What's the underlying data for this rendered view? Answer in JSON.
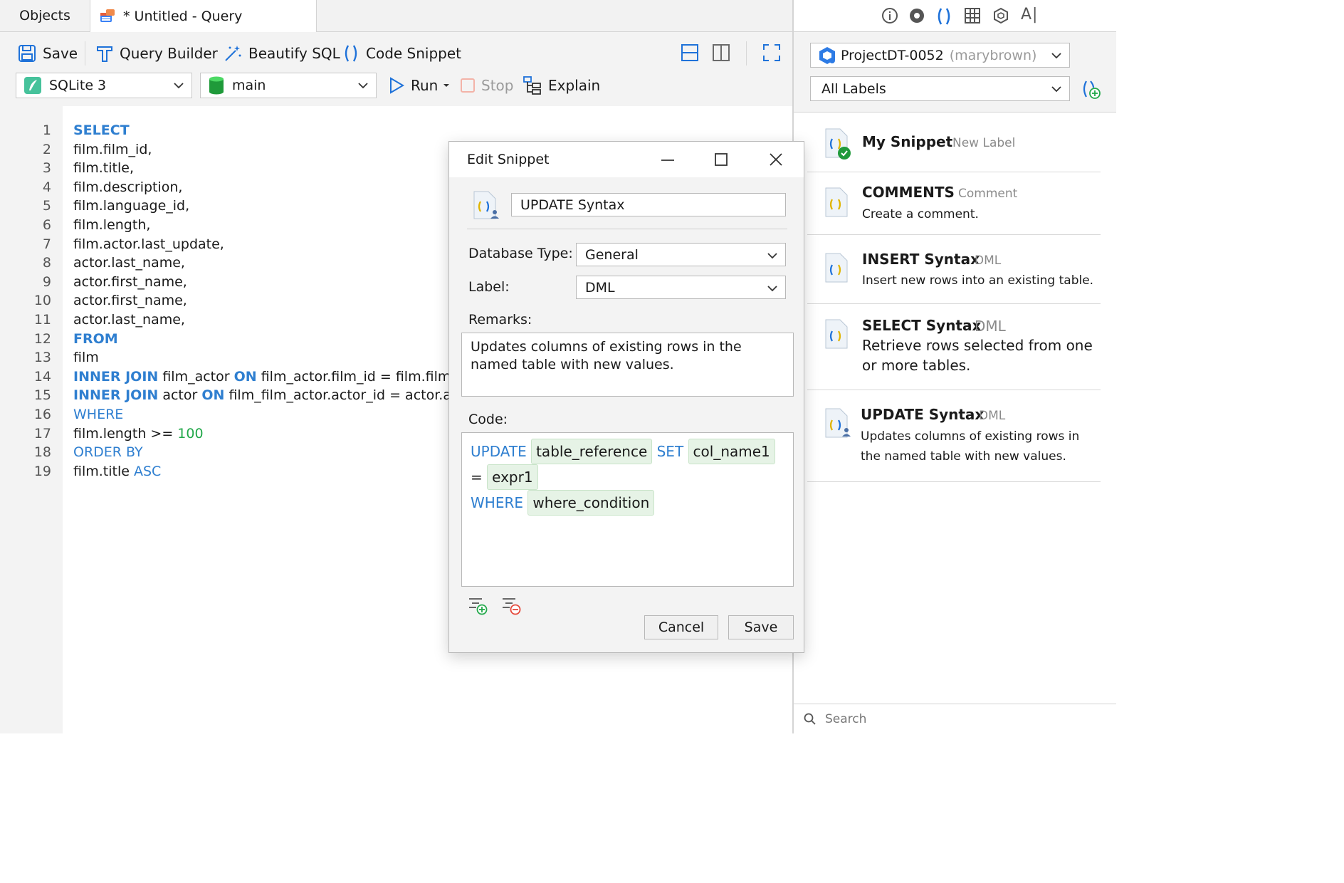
{
  "tabs": {
    "objects": "Objects",
    "query": "* Untitled - Query"
  },
  "toolbar": {
    "save": "Save",
    "query_builder": "Query Builder",
    "beautify": "Beautify SQL",
    "code_snippet": "Code Snippet",
    "connection": "SQLite 3",
    "database": "main",
    "run": "Run",
    "stop": "Stop",
    "explain": "Explain"
  },
  "editor": {
    "line_numbers": [
      "1",
      "2",
      "3",
      "4",
      "5",
      "6",
      "7",
      "8",
      "9",
      "10",
      "11",
      "12",
      "13",
      "14",
      "15",
      "16",
      "17",
      "18",
      "19"
    ],
    "lines": [
      [
        {
          "t": "SELECT",
          "c": "kwb"
        }
      ],
      [
        {
          "t": "film.film_id,"
        }
      ],
      [
        {
          "t": "film.title,"
        }
      ],
      [
        {
          "t": "film.description,"
        }
      ],
      [
        {
          "t": "film.language_id,"
        }
      ],
      [
        {
          "t": "film.length,"
        }
      ],
      [
        {
          "t": "film.actor.last_update,"
        }
      ],
      [
        {
          "t": "actor.last_name,"
        }
      ],
      [
        {
          "t": "actor.first_name,"
        }
      ],
      [
        {
          "t": "actor.first_name,"
        }
      ],
      [
        {
          "t": "actor.last_name,"
        }
      ],
      [
        {
          "t": "FROM",
          "c": "kwb"
        }
      ],
      [
        {
          "t": "film"
        }
      ],
      [
        {
          "t": "INNER JOIN",
          "c": "kwb"
        },
        {
          "t": " film_actor "
        },
        {
          "t": "ON",
          "c": "kwb"
        },
        {
          "t": " film_actor.film_id = film.film._id"
        }
      ],
      [
        {
          "t": "INNER JOIN",
          "c": "kwb"
        },
        {
          "t": " actor "
        },
        {
          "t": "ON",
          "c": "kwb"
        },
        {
          "t": " film_film_actor.actor_id = actor.actor_id"
        }
      ],
      [
        {
          "t": "WHERE",
          "c": "kw"
        }
      ],
      [
        {
          "t": "film.length >= "
        },
        {
          "t": "100",
          "c": "num"
        }
      ],
      [
        {
          "t": "ORDER BY",
          "c": "kw"
        }
      ],
      [
        {
          "t": "film.title "
        },
        {
          "t": "ASC",
          "c": "kw"
        }
      ]
    ]
  },
  "right_panel": {
    "project": "ProjectDT-0052",
    "project_user": "(marybrown)",
    "labels_filter": "All Labels",
    "snippets": [
      {
        "title": "My Snippet",
        "label": "New Label",
        "desc": ""
      },
      {
        "title": "COMMENTS",
        "label": "Comment",
        "desc": "Create a comment."
      },
      {
        "title": "INSERT Syntax",
        "label": "DML",
        "desc": "Insert new rows into an existing table."
      },
      {
        "title": "SELECT Syntax",
        "label": "DML",
        "desc": "Retrieve rows selected from one or more tables."
      },
      {
        "title": "UPDATE Syntax",
        "label": "DML",
        "desc": "Updates columns of existing rows in the named table with new values."
      }
    ],
    "search_placeholder": "Search"
  },
  "dialog": {
    "title": "Edit Snippet",
    "name": "UPDATE Syntax",
    "db_type_label": "Database Type:",
    "db_type": "General",
    "label_label": "Label:",
    "label": "DML",
    "remarks_label": "Remarks:",
    "remarks": "Updates columns of existing rows in the named table with new values.",
    "code_label": "Code:",
    "code": {
      "kw_update": "UPDATE",
      "table_ref": "table_reference",
      "kw_set": "SET",
      "col": "col_name1",
      "eq": "=",
      "expr": "expr1",
      "kw_where": "WHERE",
      "cond": "where_condition"
    },
    "cancel": "Cancel",
    "save": "Save"
  },
  "colors": {
    "keyword": "#2f7fd0",
    "number": "#22a84a",
    "token_bg": "#e6f3e6",
    "accent": "#1f72d9"
  },
  "icons": [
    "save-icon",
    "query-builder-icon",
    "beautify-icon",
    "code-snippet-icon",
    "layout-horizontal-icon",
    "layout-vertical-icon",
    "fullscreen-icon",
    "sqlite-icon",
    "database-icon",
    "run-icon",
    "stop-icon",
    "explain-icon",
    "info-icon",
    "eye-icon",
    "snippet-icon",
    "grid-icon",
    "cube-icon",
    "ai-icon",
    "project-icon",
    "add-label-icon",
    "search-icon",
    "close-icon",
    "minimize-icon",
    "maximize-icon",
    "add-placeholder-icon",
    "remove-placeholder-icon"
  ]
}
